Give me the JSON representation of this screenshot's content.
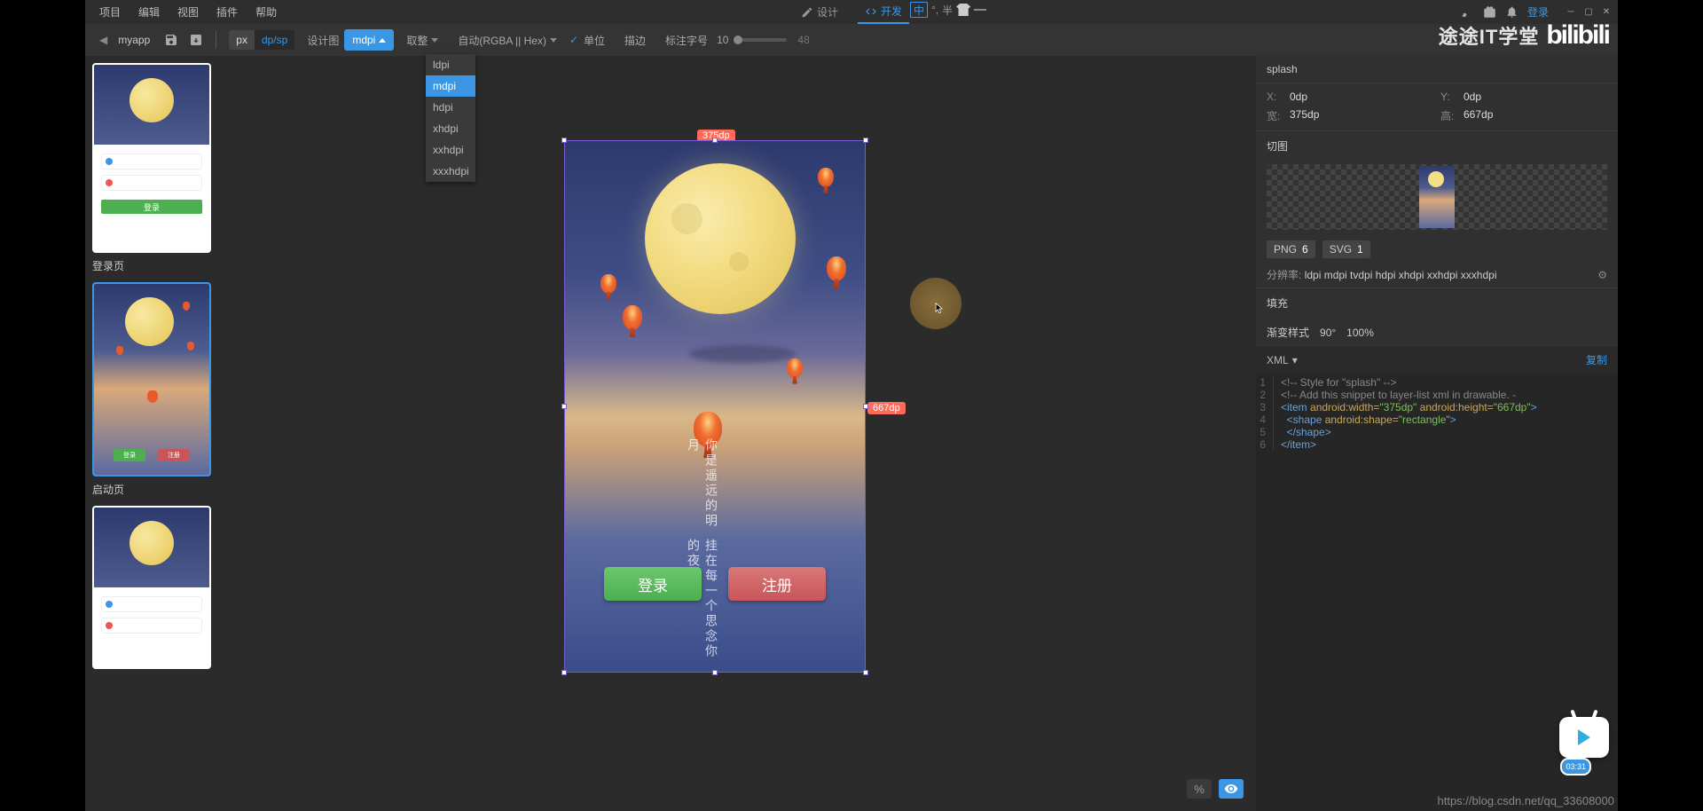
{
  "menubar": {
    "items": [
      "项目",
      "编辑",
      "视图",
      "插件",
      "帮助"
    ],
    "tabs": {
      "design": "设计",
      "develop": "开发"
    },
    "ime": {
      "char": "中",
      "sep": "°,",
      "half": "半"
    },
    "login": "登录"
  },
  "toolbar": {
    "breadcrumb": "myapp",
    "unit_px": "px",
    "unit_dpsp": "dp/sp",
    "design_label": "设计图",
    "dpi_selected": "mdpi",
    "dpi_options": [
      "ldpi",
      "mdpi",
      "hdpi",
      "xhdpi",
      "xxhdpi",
      "xxxhdpi"
    ],
    "round": "取整",
    "colormode": "自动(RGBA || Hex)",
    "unit_chk": "单位",
    "stroke": "描边",
    "fontsize_label": "标注字号",
    "fontsize_val": "10",
    "slider_max": "48",
    "brand": "途途IT学堂",
    "bili": "bilibili"
  },
  "thumbnails": {
    "t1_label": "登录页",
    "t1_btn": "登录",
    "t2_label": "启动页",
    "t2_btn_login": "登录",
    "t2_btn_reg": "注册"
  },
  "artboard": {
    "width_label": "375dp",
    "height_label": "667dp",
    "poem_line2": "挂在每一个思念你的夜",
    "poem_line1": "你是遥远的明月",
    "btn_login": "登录",
    "btn_register": "注册"
  },
  "canvas_controls": {
    "percent": "%",
    "eye": "eye"
  },
  "inspector": {
    "title": "splash",
    "x_lbl": "X:",
    "x_val": "0dp",
    "y_lbl": "Y:",
    "y_val": "0dp",
    "w_lbl": "宽:",
    "w_val": "375dp",
    "h_lbl": "高:",
    "h_val": "667dp",
    "slice": "切图",
    "png": "PNG",
    "png_n": "6",
    "svg": "SVG",
    "svg_n": "1",
    "res_lbl": "分辨率:",
    "res_val": "ldpi mdpi tvdpi hdpi xhdpi xxhdpi xxxhdpi",
    "fill": "填充",
    "grad_lbl": "渐变样式",
    "grad_angle": "90°",
    "grad_pct": "100%",
    "xml": "XML",
    "copy": "复制"
  },
  "code": {
    "l1": "<!-- Style for \"splash\" -->",
    "l2": "<!-- Add this snippet to layer-list xml in drawable. -",
    "l3_tag": "<item",
    "l3_a1": " android:width=",
    "l3_v1": "\"375dp\"",
    "l3_a2": " android:height=",
    "l3_v2": "\"667dp\"",
    "l3_end": ">",
    "l4_tag": "  <shape",
    "l4_a1": " android:shape=",
    "l4_v1": "\"rectangle\"",
    "l4_end": ">",
    "l5": "  </shape>",
    "l6": "</item>"
  },
  "footer": {
    "url": "https://blog.csdn.net/qq_33608000",
    "time": "03:31"
  }
}
